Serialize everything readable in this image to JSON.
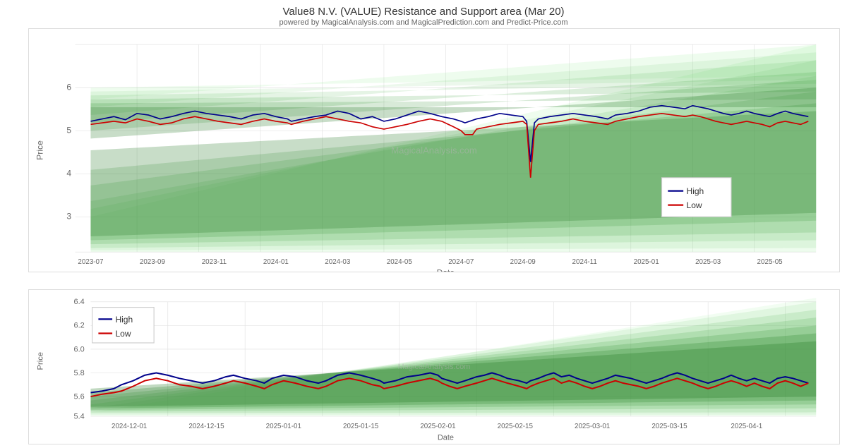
{
  "page": {
    "title": "Value8 N.V. (VALUE) Resistance and Support area (Mar 20)",
    "powered_by": "powered by MagicalAnalysis.com and MagicalPrediction.com and Predict-Price.com"
  },
  "chart_top": {
    "y_label": "Price",
    "x_label": "Date",
    "y_axis": [
      "6",
      "5",
      "4",
      "3"
    ],
    "x_axis": [
      "2023-07",
      "2023-09",
      "2023-11",
      "2024-01",
      "2024-03",
      "2024-05",
      "2024-07",
      "2024-09",
      "2024-11",
      "2025-01",
      "2025-03",
      "2025-05"
    ],
    "legend": {
      "high_label": "High",
      "low_label": "Low",
      "high_color": "#00008B",
      "low_color": "#CC0000"
    }
  },
  "chart_bottom": {
    "y_label": "Price",
    "x_label": "Date",
    "y_axis": [
      "6.4",
      "6.2",
      "6.0",
      "5.8",
      "5.6",
      "5.4"
    ],
    "x_axis": [
      "2024-12-01",
      "2024-12-15",
      "2025-01-01",
      "2025-01-15",
      "2025-02-01",
      "2025-02-15",
      "2025-03-01",
      "2025-03-15",
      "2025-04-1"
    ],
    "legend": {
      "high_label": "High",
      "low_label": "Low",
      "high_color": "#00008B",
      "low_color": "#CC0000"
    }
  }
}
